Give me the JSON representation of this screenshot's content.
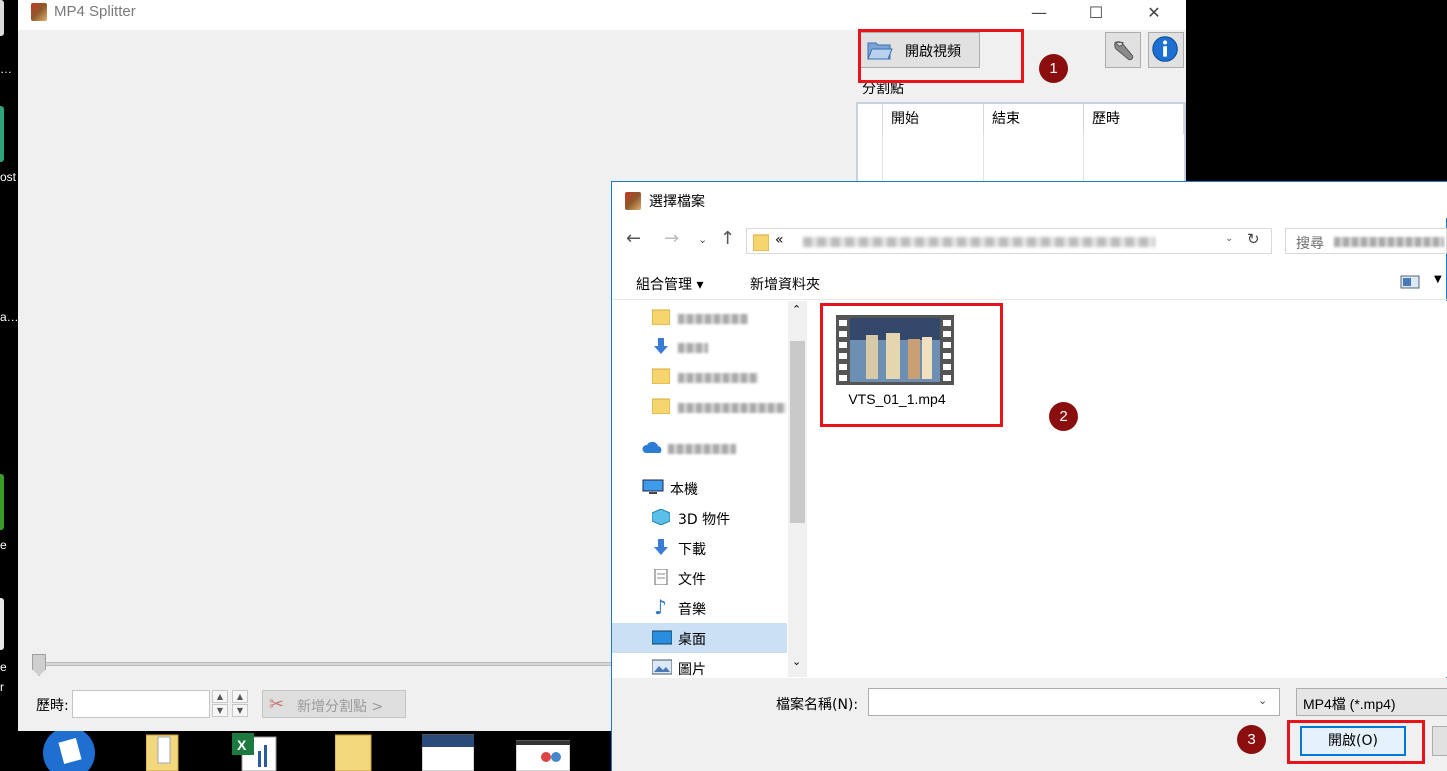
{
  "desktop": {
    "fragments": [
      "…",
      "ost",
      "a…",
      "e",
      "e",
      "r"
    ]
  },
  "main_window": {
    "title": "MP4 Splitter",
    "controls": {
      "minimize": "—",
      "maximize": "☐",
      "close": "✕"
    },
    "open_video_label": "開啟視頻",
    "tools_icon": "wrench-icon",
    "info_icon": "info-icon",
    "split_points_label": "分割點",
    "table_headers": [
      "開始",
      "結束",
      "歷時"
    ],
    "duration_label": "歷時:",
    "duration_value": "",
    "add_split_label": "新增分割點 >"
  },
  "dialog": {
    "title": "選擇檔案",
    "address_prefix": "«",
    "search_placeholder": "搜尋",
    "toolbar": {
      "organize": "組合管理 ▾",
      "new_folder": "新增資料夾"
    },
    "nav_items": [
      {
        "label": "20170319",
        "icon": "folder-icon"
      },
      {
        "label": "下載",
        "icon": "download-icon"
      },
      {
        "label": "",
        "icon": "folder-icon"
      },
      {
        "label": "",
        "icon": "folder-icon"
      },
      {
        "label": "OneDrive",
        "icon": "onedrive-icon"
      },
      {
        "label": "本機",
        "icon": "computer-icon"
      },
      {
        "label": "3D 物件",
        "icon": "cube-icon"
      },
      {
        "label": "下載",
        "icon": "download-icon"
      },
      {
        "label": "文件",
        "icon": "document-icon"
      },
      {
        "label": "音樂",
        "icon": "music-icon"
      },
      {
        "label": "桌面",
        "icon": "desktop-icon"
      },
      {
        "label": "圖片",
        "icon": "pictures-icon"
      }
    ],
    "file": {
      "name": "VTS_01_1.mp4"
    },
    "filename_label": "檔案名稱(N):",
    "filename_value": "",
    "filetype_value": "MP4檔 (*.mp4)",
    "open_label": "開啟(O)"
  },
  "annotations": {
    "badges": [
      "1",
      "2",
      "3"
    ]
  },
  "colors": {
    "annotation": "#e8141c",
    "badge": "#8b0e0e",
    "accent": "#0078d7"
  }
}
